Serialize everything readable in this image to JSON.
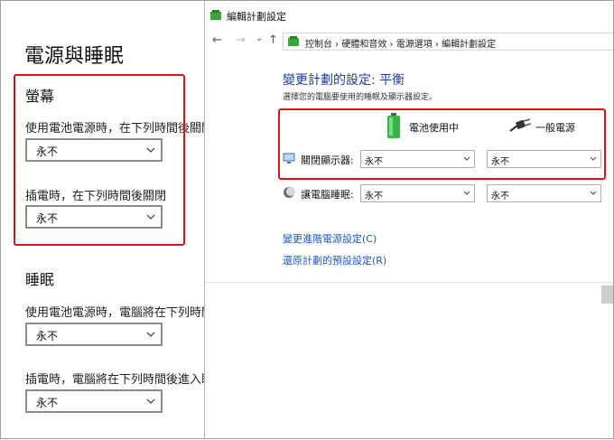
{
  "settings": {
    "title": "電源與睡眠",
    "screen_section": "螢幕",
    "screen_battery_label": "使用電池電源時，在下列時間後關閉",
    "screen_battery_value": "永不",
    "screen_plugged_label": "插電時，在下列時間後關閉",
    "screen_plugged_value": "永不",
    "sleep_section": "睡眠",
    "sleep_battery_label": "使用電池電源時，電腦將在下列時間",
    "sleep_battery_value": "永不",
    "sleep_plugged_label": "插電時，電腦將在下列時間後進入睡",
    "sleep_plugged_value": "永不"
  },
  "window": {
    "title": "編輯計劃設定",
    "breadcrumbs": "控制台  ›  硬體和音效  ›  電源選項  ›  編輯計劃設定",
    "nav": {
      "back": "←",
      "forward": "→",
      "recent": "⌄",
      "up": "↑"
    },
    "heading": "變更計劃的設定: 平衡",
    "subtext": "選擇您的電腦要使用的睡眠及顯示器設定。",
    "col_battery": "電池使用中",
    "col_plugged": "一般電源",
    "rows": [
      {
        "label": "關閉顯示器:",
        "battery": "永不",
        "plugged": "永不"
      },
      {
        "label": "讓電腦睡眠:",
        "battery": "永不",
        "plugged": "永不"
      }
    ],
    "link_advanced": "變更進階電源設定(C)",
    "link_restore": "還原計劃的預設設定(R)"
  },
  "colors": {
    "accent_heading": "#1e3f99",
    "link": "#1a57c4",
    "highlight_box": "#d8141b"
  },
  "icons": [
    "chevron-down-icon",
    "power-options-icon",
    "battery-icon",
    "power-plug-icon",
    "monitor-icon",
    "sleep-moon-icon"
  ]
}
